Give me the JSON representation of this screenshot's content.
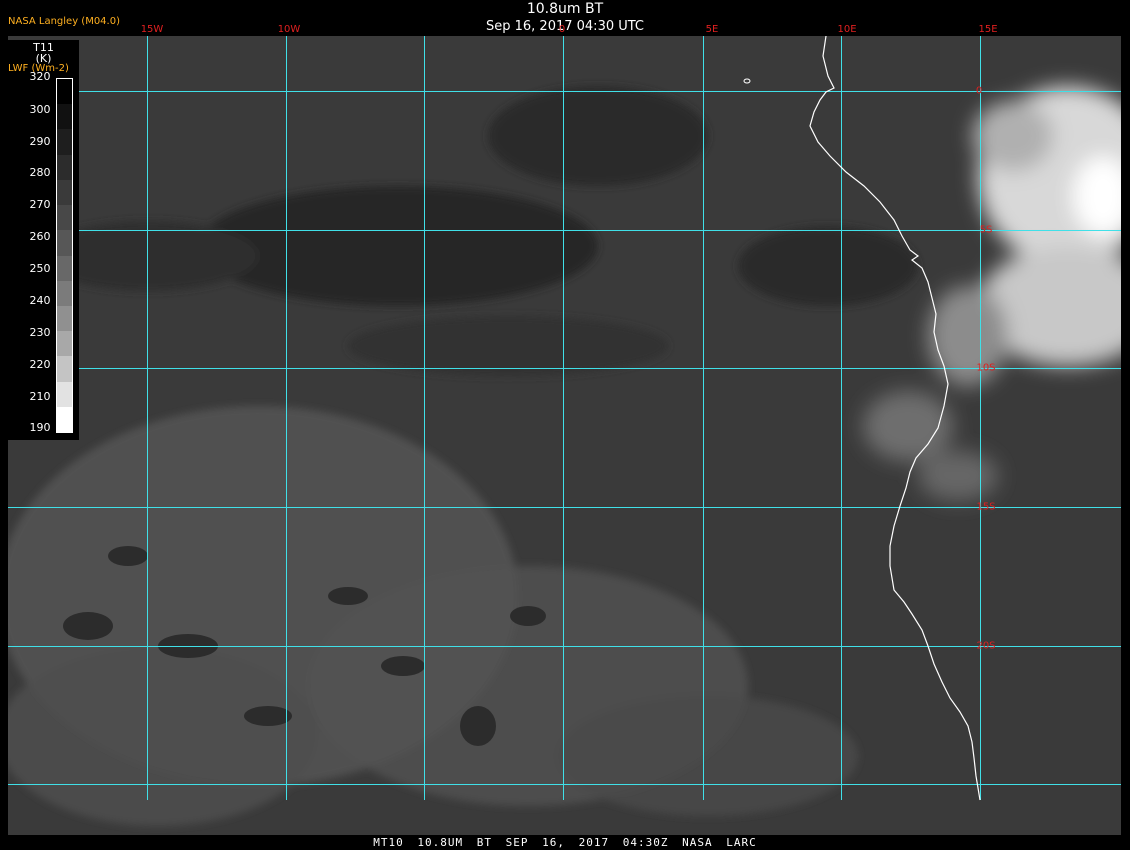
{
  "header": {
    "title": "10.8um BT",
    "subtitle": "Sep 16, 2017 04:30 UTC",
    "agency": "NASA Langley (M04.0)"
  },
  "legend": {
    "title": "T11",
    "units": "(K)",
    "sub_label": "LWF (Wm-2)",
    "ticks": [
      "320",
      "300",
      "290",
      "280",
      "270",
      "260",
      "250",
      "240",
      "230",
      "220",
      "210",
      "190"
    ],
    "colors": [
      "#000000",
      "#111111",
      "#1e1e1e",
      "#2c2c2c",
      "#3a3a3a",
      "#484848",
      "#575757",
      "#686868",
      "#7b7b7b",
      "#909090",
      "#a8a8a8",
      "#c4c4c4",
      "#e2e2e2",
      "#ffffff"
    ]
  },
  "grid": {
    "longitudes": [
      "15W",
      "10W",
      "0",
      "5E",
      "10E",
      "15E"
    ],
    "latitudes": [
      "0",
      "5S",
      "10S",
      "15S",
      "20S"
    ],
    "grid_color": "#40e0e8",
    "label_color": "#e02020"
  },
  "map": {
    "region": "Southeast Atlantic / Southwest Africa coast",
    "coastline_color": "#ffffff"
  },
  "footer": {
    "text": "MT10   10.8UM BT   SEP 16, 2017 04:30Z   NASA LARC"
  }
}
